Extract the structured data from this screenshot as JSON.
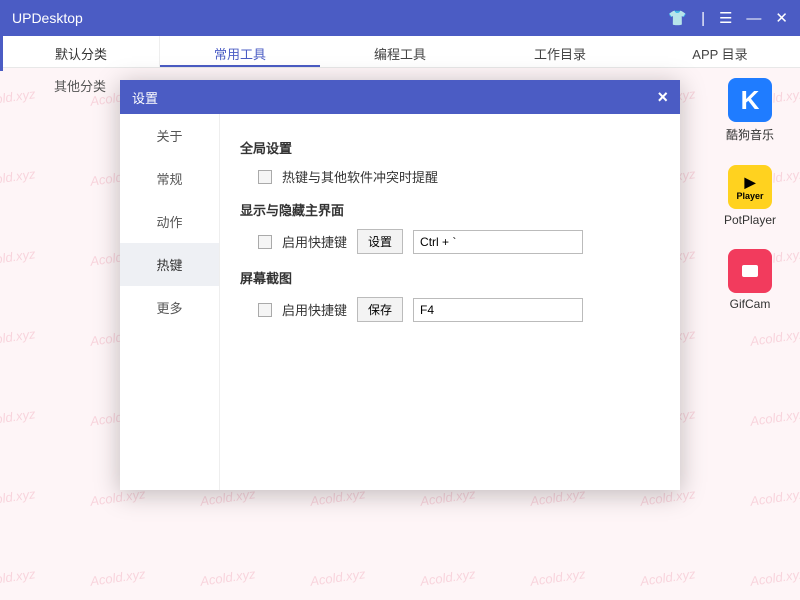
{
  "app": {
    "title": "UPDesktop"
  },
  "categories": [
    "默认分类",
    "其他分类"
  ],
  "tabs": [
    "常用工具",
    "编程工具",
    "工作目录",
    "APP 目录"
  ],
  "apps": [
    {
      "name": "酷狗音乐",
      "iconClass": "icon-kg",
      "glyph": "K"
    },
    {
      "name": "PotPlayer",
      "iconClass": "icon-pot",
      "glyph": "Player"
    },
    {
      "name": "GifCam",
      "iconClass": "icon-gif",
      "glyph": ""
    }
  ],
  "dialog": {
    "title": "设置",
    "nav": [
      "关于",
      "常规",
      "动作",
      "热键",
      "更多"
    ],
    "navActive": 3,
    "sections": {
      "global": {
        "title": "全局设置",
        "conflict_label": "热键与其他软件冲突时提醒"
      },
      "toggle": {
        "title": "显示与隐藏主界面",
        "enable_label": "启用快捷键",
        "btn": "设置",
        "value": "Ctrl + `"
      },
      "screenshot": {
        "title": "屏幕截图",
        "enable_label": "启用快捷键",
        "btn": "保存",
        "value": "F4"
      }
    }
  },
  "watermark": "Acold.xyz"
}
